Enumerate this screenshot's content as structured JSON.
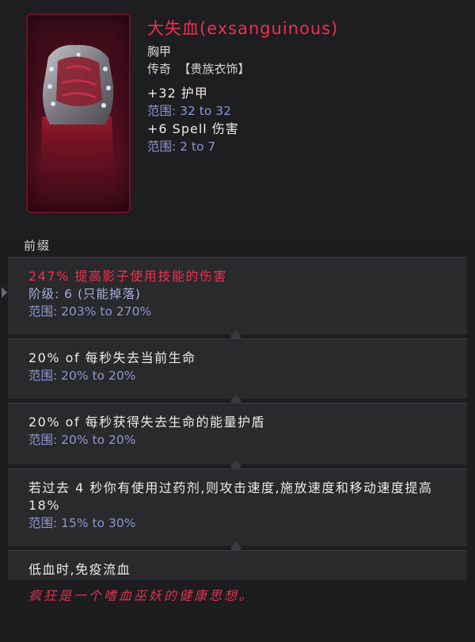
{
  "item": {
    "name": "大失血(exsanguinous)",
    "slot": "胸甲",
    "rarity_line": "传奇  【贵族衣饰】",
    "icon": "blood-armor-icon",
    "base_stats": [
      {
        "stat": "+32 护甲",
        "range": "范围: 32 to 32"
      },
      {
        "stat": "+6 Spell 伤害",
        "range": "范围: 2 to 7"
      }
    ]
  },
  "prefix_label": "前缀",
  "affixes": [
    {
      "main": "247% 提高影子使用技能的伤害",
      "tier": "阶级: 6 (只能掉落)",
      "range": "范围: 203% to 270%"
    },
    {
      "main": "20% of 每秒失去当前生命",
      "range": "范围: 20% to 20%"
    },
    {
      "main": "20% of 每秒获得失去生命的能量护盾",
      "range": "范围: 20% to 20%"
    },
    {
      "main": "若过去 4 秒你有使用过药剂,则攻击速度,施放速度和移动速度提高 18%",
      "range": "范围: 15% to 30%"
    },
    {
      "main": "低血时,免疫流血"
    }
  ],
  "flavor": "疯狂是一个嗜血巫妖的健康思想。",
  "colors": {
    "name": "#e8334f",
    "range": "#8c98cf",
    "panel": "#2a292c",
    "background": "#1d1c1f"
  }
}
